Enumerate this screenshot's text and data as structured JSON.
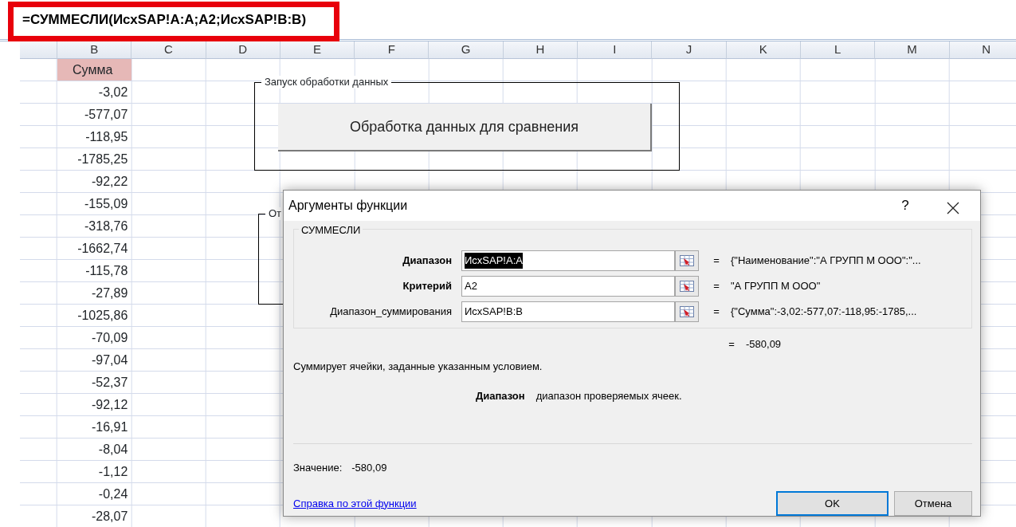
{
  "formula_bar": {
    "formula": "=СУММЕСЛИ(ИсхSAP!A:A;A2;ИсхSAP!B:B)",
    "highlighted": true
  },
  "sheet": {
    "columns": [
      "B",
      "C",
      "D",
      "E",
      "F",
      "G",
      "H",
      "I",
      "J",
      "K",
      "L",
      "M",
      "N"
    ],
    "header_cell": "Сумма",
    "values": [
      "-3,02",
      "-577,07",
      "-118,95",
      "-1785,25",
      "-92,22",
      "-155,09",
      "-318,76",
      "-1662,74",
      "-115,78",
      "-27,89",
      "-1025,86",
      "-70,09",
      "-97,04",
      "-52,37",
      "-92,12",
      "-16,91",
      "-8,04",
      "-1,12",
      "-0,24",
      "-28,07"
    ]
  },
  "group_boxes": [
    {
      "label": "Запуск обработки данных",
      "button": "Обработка данных для сравнения"
    },
    {
      "label": "От"
    }
  ],
  "dialog": {
    "title": "Аргументы функции",
    "help": "?",
    "function_name": "СУММЕСЛИ",
    "arguments": [
      {
        "label": "Диапазон",
        "bold": true,
        "value": "ИсхSAP!A:A",
        "selected": true,
        "equals": "=",
        "result": "{\"Наименование\":\"А ГРУПП М ООО\":\"..."
      },
      {
        "label": "Критерий",
        "bold": true,
        "value": "A2",
        "selected": false,
        "equals": "=",
        "result": "\"А ГРУПП М ООО\""
      },
      {
        "label": "Диапазон_суммирования",
        "bold": false,
        "value": "ИсхSAP!B:B",
        "selected": false,
        "equals": "=",
        "result": "{\"Сумма\":-3,02:-577,07:-118,95:-1785,..."
      }
    ],
    "total_equals": "=",
    "total": "-580,09",
    "description": "Суммирует ячейки, заданные указанным условием.",
    "arg_help_name": "Диапазон",
    "arg_help_text": "диапазон проверяемых ячеек.",
    "value_label": "Значение:",
    "value": "-580,09",
    "help_link": "Справка по этой функции",
    "buttons": [
      {
        "label": "OK",
        "default": true
      },
      {
        "label": "Отмена",
        "default": false
      }
    ]
  }
}
